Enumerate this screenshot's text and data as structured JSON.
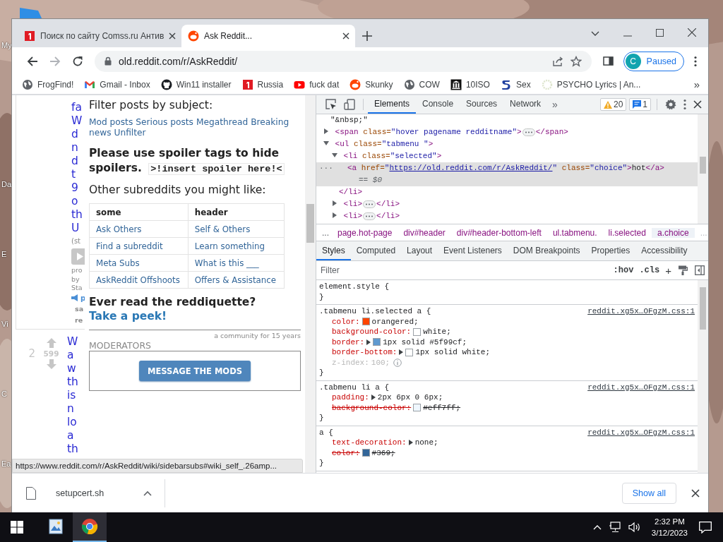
{
  "desktop": {
    "icon_labels": [
      "My",
      "Da",
      "E",
      "Vi",
      "C",
      "Ea"
    ]
  },
  "browser": {
    "tabs": [
      {
        "title": "Поиск по сайту Comss.ru Антив",
        "kind": "red-square",
        "selected": false
      },
      {
        "title": "Ask Reddit...",
        "kind": "reddit",
        "selected": true
      }
    ],
    "nav": {
      "back": {
        "disabled": false
      },
      "forward": {
        "disabled": true
      }
    },
    "url": "old.reddit.com/r/AskReddit/",
    "profile": {
      "initial": "C",
      "status": "Paused"
    },
    "bookmarks": [
      {
        "label": "FrogFind!",
        "kind": "globe"
      },
      {
        "label": "Gmail - Inbox",
        "kind": "gmail"
      },
      {
        "label": "Win11 installer",
        "kind": "github"
      },
      {
        "label": "Russia",
        "kind": "red-square"
      },
      {
        "label": "fuck dat",
        "kind": "youtube"
      },
      {
        "label": "Skunky",
        "kind": "reddit"
      },
      {
        "label": "COW",
        "kind": "globe"
      },
      {
        "label": "10ISO",
        "kind": "museum"
      },
      {
        "label": "Sex",
        "kind": "s-logo"
      },
      {
        "label": "PSYCHO Lyrics | An...",
        "kind": "spinner"
      }
    ],
    "bookmarks_overflow": "»"
  },
  "page": {
    "posts": [
      {
        "title_fragments": [
          "fa",
          "W",
          "d",
          "n",
          "d",
          "t",
          "9",
          "o",
          "th",
          "U"
        ],
        "tagline": "(st",
        "byline_fragments": [
          "pro",
          "by",
          "Sta"
        ],
        "flair": "p",
        "button_fragments": [
          "sa",
          "re"
        ]
      },
      {
        "rank": "2",
        "score": "599",
        "title_fragments": [
          "W",
          "a",
          "w",
          "th",
          "is",
          "n",
          "lo",
          "a",
          "th"
        ]
      }
    ],
    "sidebar": {
      "filter_heading": "Filter posts by subject:",
      "filter_links": [
        "Mod posts",
        "Serious posts",
        "Megathread",
        "Breaking",
        "news",
        "Unfilter"
      ],
      "spoiler_heading": "Please use spoiler tags to hide spoilers.",
      "spoiler_code": ">!insert spoiler here!<",
      "other_heading": "Other subreddits you might like:",
      "table": {
        "columns": [
          "some",
          "header"
        ],
        "rows": [
          [
            "Ask Others",
            "Self & Others"
          ],
          [
            "Find a subreddit",
            "Learn something"
          ],
          [
            "Meta Subs",
            "What is this ___"
          ],
          [
            "AskReddit Offshoots",
            "Offers & Assistance"
          ]
        ]
      },
      "reddiquette_text": "Ever read the reddiquette?",
      "reddiquette_link": "Take a peek!",
      "community_age": "a community for 15 years",
      "moderators_heading": "MODERATORS",
      "message_button": "MESSAGE THE MODS"
    },
    "status_url": "https://www.reddit.com/r/AskReddit/wiki/sidebarsubs#wiki_self_.26amp..."
  },
  "devtools": {
    "tabs": [
      {
        "label": "Elements",
        "selected": true
      },
      {
        "label": "Console",
        "selected": false
      },
      {
        "label": "Sources",
        "selected": false
      },
      {
        "label": "Network",
        "selected": false
      }
    ],
    "tabs_overflow": "»",
    "warnings": "20",
    "messages": "1",
    "dom": [
      {
        "kind": "text",
        "text": "\"&nbsp;\"",
        "selected": false
      },
      {
        "kind": "element",
        "open": "<span class=\"hover pagename redditname\">",
        "close": "</span>",
        "expanded": false,
        "selected": false
      },
      {
        "kind": "element",
        "open": "<ul class=\"tabmenu \">",
        "expanded": true,
        "selected": false,
        "children": [
          {
            "kind": "element",
            "open": "<li class=\"selected\">",
            "close": "</li>",
            "expanded": true,
            "selected": false,
            "children": [
              {
                "kind": "element",
                "open": "<a href=\"",
                "link": "https://old.reddit.com/r/AskReddit/",
                "rest": "\" class=\"choice\">hot</a>",
                "note": "== $0",
                "gutter": "···",
                "selected": true
              }
            ]
          },
          {
            "kind": "element",
            "open": "<li>",
            "close": "</li>",
            "expanded": false,
            "selected": false
          },
          {
            "kind": "element",
            "open": "<li>",
            "close": "</li>",
            "expanded": false,
            "selected": false
          }
        ]
      }
    ],
    "breadcrumbs": [
      {
        "label": "page.hot-page",
        "selected": false
      },
      {
        "label": "div#header",
        "selected": false
      },
      {
        "label": "div#header-bottom-left",
        "selected": false
      },
      {
        "label": "ul.tabmenu.",
        "selected": false
      },
      {
        "label": "li.selected",
        "selected": false
      },
      {
        "label": "a.choice",
        "selected": true
      }
    ],
    "breadcrumb_scroll": [
      "...",
      "..."
    ],
    "pane_tabs": [
      {
        "label": "Styles",
        "selected": true
      },
      {
        "label": "Computed",
        "selected": false
      },
      {
        "label": "Layout",
        "selected": false
      },
      {
        "label": "Event Listeners",
        "selected": false
      },
      {
        "label": "DOM Breakpoints",
        "selected": false
      },
      {
        "label": "Properties",
        "selected": false
      },
      {
        "label": "Accessibility",
        "selected": false
      }
    ],
    "filter_placeholder": "Filter",
    "filter_buttons": [
      ":hov",
      ".cls",
      "+"
    ],
    "rules": [
      {
        "selector": "element.style {",
        "close": "}"
      },
      {
        "selector": ".tabmenu li.selected a {",
        "source": "reddit.xg5x…OFgzM.css:1",
        "close": "}",
        "props": [
          {
            "name": "color:",
            "value": "orangered;",
            "color": "#ff4500",
            "expandable": false,
            "overridden": false,
            "inactive": false
          },
          {
            "name": "background-color:",
            "value": "white;",
            "color": "#ffffff",
            "expandable": false,
            "overridden": false,
            "inactive": false
          },
          {
            "name": "border:",
            "value": "1px solid #5f99cf;",
            "color": "#5f99cf",
            "expandable": true,
            "overridden": false,
            "inactive": false
          },
          {
            "name": "border-bottom:",
            "value": "1px solid white;",
            "color": "#ffffff",
            "expandable": true,
            "overridden": false,
            "inactive": false
          },
          {
            "name": "z-index:",
            "value": "100;",
            "expandable": false,
            "overridden": false,
            "inactive": true,
            "info": true
          }
        ]
      },
      {
        "selector": ".tabmenu li a {",
        "source": "reddit.xg5x…OFgzM.css:1",
        "close": "}",
        "props": [
          {
            "name": "padding:",
            "value": "2px 6px 0 6px;",
            "expandable": true,
            "overridden": false,
            "inactive": false
          },
          {
            "name": "background-color:",
            "value": "#eff7ff;",
            "color": "#eff7ff",
            "expandable": false,
            "overridden": true,
            "inactive": false
          }
        ]
      },
      {
        "selector": "a {",
        "source": "reddit.xg5x…OFgzM.css:1",
        "close": "}",
        "props": [
          {
            "name": "text-decoration:",
            "value": "none;",
            "expandable": true,
            "overridden": false,
            "inactive": false
          },
          {
            "name": "color:",
            "value": "#369;",
            "color": "#336699",
            "expandable": false,
            "overridden": true,
            "inactive": false
          }
        ]
      }
    ]
  },
  "downloads": {
    "file": "setupcert.sh",
    "show_all": "Show all"
  },
  "taskbar": {
    "apps": [
      {
        "kind": "photos",
        "active": false
      },
      {
        "kind": "chrome",
        "active": true
      }
    ],
    "time": "2:32 PM",
    "date": "3/12/2023"
  }
}
